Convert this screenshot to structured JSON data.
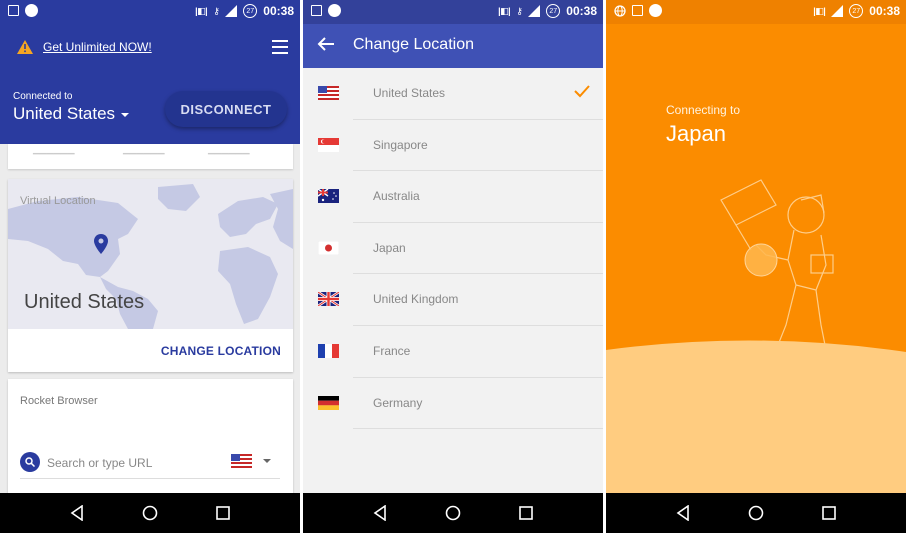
{
  "status": {
    "time": "00:38",
    "battery": "27"
  },
  "panel1": {
    "promo_text": "Get Unlimited NOW!",
    "connected_to_label": "Connected to",
    "connected_country": "United States",
    "disconnect_label": "DISCONNECT",
    "virtual_location_label": "Virtual Location",
    "virtual_location_country": "United States",
    "change_location_label": "CHANGE LOCATION",
    "rocket_browser_title": "Rocket Browser",
    "search_placeholder": "Search or type URL"
  },
  "panel2": {
    "title": "Change Location",
    "selected": "United States",
    "locations": [
      {
        "name": "United States",
        "flag": "us-flag-icon"
      },
      {
        "name": "Singapore",
        "flag": "sg-flag-icon"
      },
      {
        "name": "Australia",
        "flag": "au-flag-icon"
      },
      {
        "name": "Japan",
        "flag": "jp-flag-icon"
      },
      {
        "name": "United Kingdom",
        "flag": "gb-flag-icon"
      },
      {
        "name": "France",
        "flag": "fr-flag-icon"
      },
      {
        "name": "Germany",
        "flag": "de-flag-icon"
      }
    ]
  },
  "panel3": {
    "connecting_label": "Connecting to",
    "connecting_country": "Japan"
  },
  "colors": {
    "header_blue": "#2a3b9f",
    "toolbar_blue": "#3f51b5",
    "accent_orange": "#fb8c00",
    "ground_orange": "#ffcc80"
  }
}
